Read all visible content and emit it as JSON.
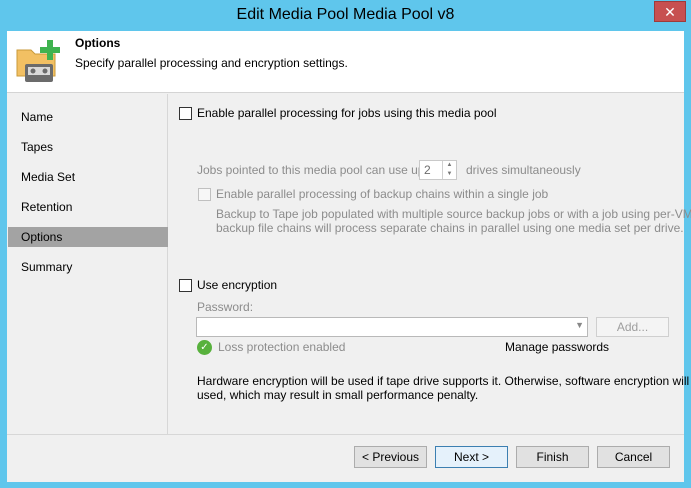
{
  "window": {
    "title": "Edit Media Pool Media Pool v8",
    "close_label": "✕"
  },
  "header": {
    "title": "Options",
    "subtitle": "Specify parallel processing and encryption settings.",
    "icon": "media-pool-add-icon"
  },
  "nav": {
    "items": [
      {
        "label": "Name"
      },
      {
        "label": "Tapes"
      },
      {
        "label": "Media Set"
      },
      {
        "label": "Retention"
      },
      {
        "label": "Options",
        "active": true
      },
      {
        "label": "Summary"
      }
    ]
  },
  "parallel": {
    "enable_label": "Enable parallel processing for jobs using this media pool",
    "enable_checked": false,
    "jobs_prefix": "Jobs pointed to this media pool can use up to",
    "drives_value": "2",
    "jobs_suffix": "drives simultaneously",
    "chains_label": "Enable parallel processing of backup chains within a single job",
    "chains_checked": false,
    "chains_desc_line1": "Backup to Tape job populated with multiple source backup jobs or with a job using per-VM",
    "chains_desc_line2": "backup file chains will process separate chains in parallel using one media set per drive."
  },
  "encryption": {
    "enable_label": "Use encryption",
    "enable_checked": false,
    "password_label": "Password:",
    "password_value": "",
    "add_label": "Add...",
    "loss_protection_label": "Loss protection enabled",
    "manage_passwords_label": "Manage passwords",
    "note_line1": "Hardware encryption will be used if tape drive supports it. Otherwise, software encryption will be",
    "note_line2": "used, which may result in small performance penalty."
  },
  "footer": {
    "previous_label": "< Previous",
    "next_label": "Next >",
    "finish_label": "Finish",
    "cancel_label": "Cancel"
  },
  "colors": {
    "titlebar": "#5fc6ec",
    "nav_active": "#a3a3a3",
    "status_ok": "#58b13d"
  }
}
